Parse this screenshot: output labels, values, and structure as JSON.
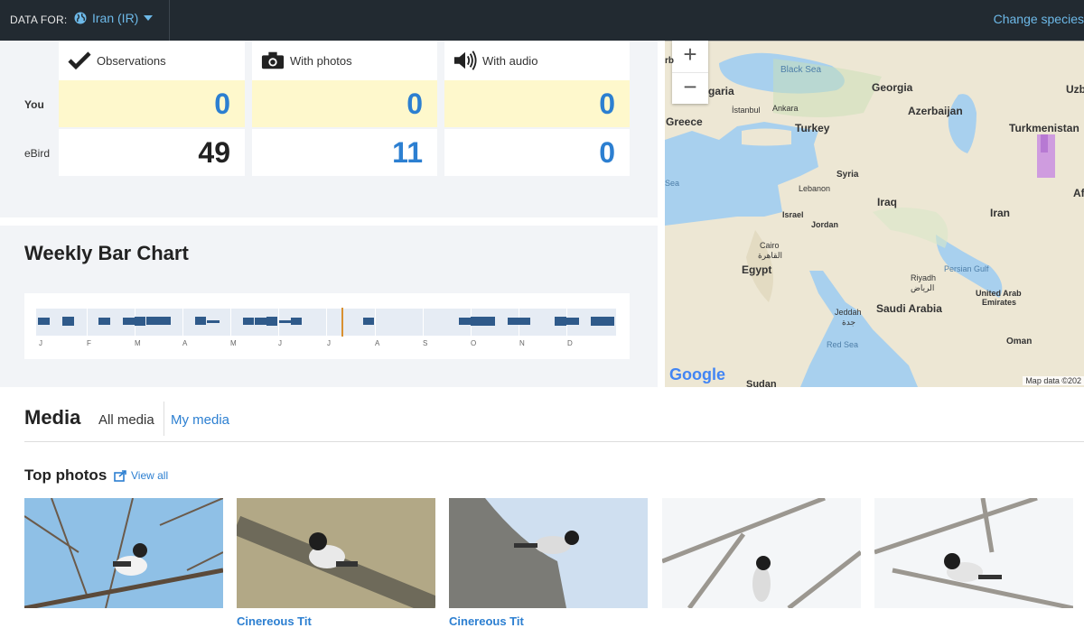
{
  "topbar": {
    "data_for_label": "DATA FOR:",
    "region": "Iran (IR)",
    "change_species": "Change species"
  },
  "stats": {
    "columns": [
      "Observations",
      "With photos",
      "With audio"
    ],
    "rows": {
      "you": {
        "label": "You",
        "values": [
          "0",
          "0",
          "0"
        ]
      },
      "ebird": {
        "label": "eBird",
        "values": [
          "49",
          "11",
          "0"
        ]
      }
    }
  },
  "chart": {
    "title": "Weekly Bar Chart",
    "months": [
      "J",
      "F",
      "M",
      "A",
      "M",
      "J",
      "J",
      "A",
      "S",
      "O",
      "N",
      "D"
    ]
  },
  "map": {
    "labels": {
      "black_sea": "Black Sea",
      "georgia": "Georgia",
      "bulgaria": "garia",
      "istanbul": "İstanbul",
      "ankara": "Ankara",
      "turkey": "Turkey",
      "azerbaijan": "Azerbaijan",
      "greece": "Greece",
      "turkmenistan": "Turkmenistan",
      "syria": "Syria",
      "lebanon": "Lebanon",
      "iraq": "Iraq",
      "israel": "Israel",
      "jordan": "Jordan",
      "iran": "Iran",
      "cairo": "Cairo",
      "cairo_ar": "القاهرة",
      "egypt": "Egypt",
      "persian_gulf": "Persian Gulf",
      "riyadh": "Riyadh",
      "riyadh_ar": "الرياض",
      "uae": "United Arab",
      "uae2": "Emirates",
      "saudi": "Saudi Arabia",
      "jeddah": "Jeddah",
      "jeddah_ar": "جدة",
      "red_sea": "Red Sea",
      "oman": "Oman",
      "sudan": "Sudan",
      "sea": "Sea",
      "uzb": "Uzb",
      "af": "Af",
      "rb": "rb",
      "google": "Google",
      "map_data": "Map data ©202"
    }
  },
  "media": {
    "title": "Media",
    "tabs": [
      "All media",
      "My media"
    ],
    "top_photos": "Top photos",
    "view_all": "View all",
    "captions": [
      "Cinereous Tit",
      "Cinereous Tit"
    ]
  },
  "colors": {
    "accent": "#2c7fd1",
    "link": "#6db9e8",
    "bar": "#2f5a8a",
    "highlight": "#fef8cc"
  }
}
